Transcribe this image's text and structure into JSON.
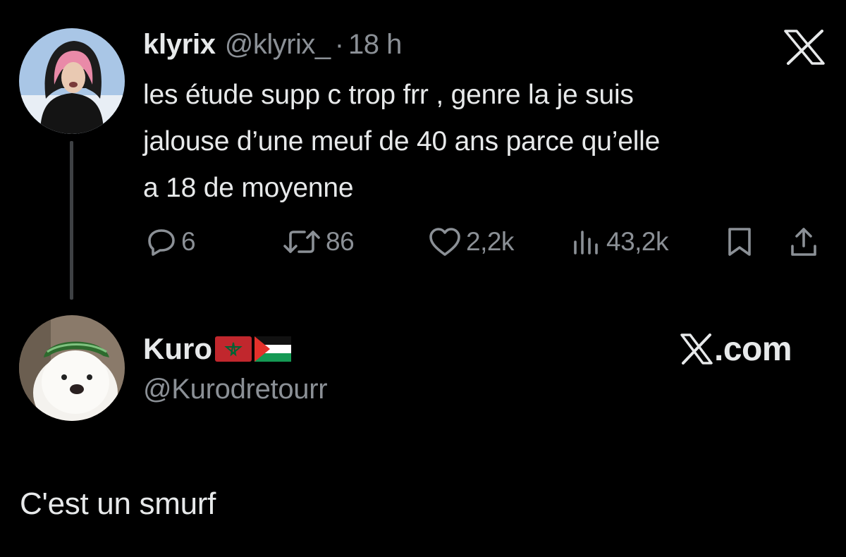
{
  "tweet": {
    "author_name": "klyrix",
    "author_handle": "@klyrix_",
    "separator": "·",
    "time": "18 h",
    "text": "les étude supp c trop frr , genre la je suis\njalouse d’une meuf de 40 ans parce qu’elle\na 18 de moyenne",
    "platform_icon": "x-logo-icon",
    "actions": {
      "replies": "6",
      "reposts": "86",
      "likes": "2,2k",
      "views": "43,2k"
    }
  },
  "reply_author": {
    "name": "Kuro",
    "flags": [
      "morocco-flag-icon",
      "palestine-flag-icon"
    ],
    "handle": "@Kurodretourr",
    "site": "X.com"
  },
  "caption": "C'est un smurf",
  "colors": {
    "background": "#000000",
    "primary_text": "#e7e9ea",
    "secondary_text": "#8b9096",
    "thread_line": "#3e4144"
  }
}
